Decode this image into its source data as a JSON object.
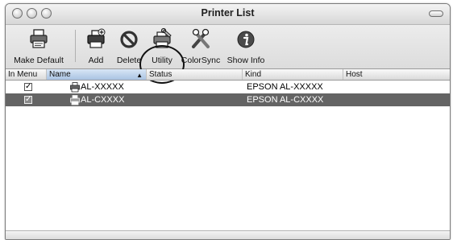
{
  "window": {
    "title": "Printer List"
  },
  "toolbar": {
    "make_default": {
      "label": "Make Default",
      "icon": "printer-icon"
    },
    "add": {
      "label": "Add",
      "icon": "printer-add-icon"
    },
    "delete": {
      "label": "Delete",
      "icon": "no-entry-icon"
    },
    "utility": {
      "label": "Utility",
      "icon": "printer-utility-icon"
    },
    "colorsync": {
      "label": "ColorSync",
      "icon": "colorsync-icon"
    },
    "show_info": {
      "label": "Show Info",
      "icon": "info-icon"
    }
  },
  "table": {
    "columns": [
      "In Menu",
      "Name",
      "Status",
      "Kind",
      "Host"
    ],
    "sorted_column": "Name",
    "rows": [
      {
        "in_menu": "✓",
        "name": "AL-XXXXX",
        "status": "",
        "kind": "EPSON AL-XXXXX",
        "host": "",
        "selected": false
      },
      {
        "in_menu": "✓",
        "name": "AL-CXXXX",
        "status": "",
        "kind": "EPSON AL-CXXXX",
        "host": "",
        "selected": true
      }
    ]
  },
  "colors": {
    "selected_row": "#646464",
    "sorted_header": "#a9c3e2"
  }
}
